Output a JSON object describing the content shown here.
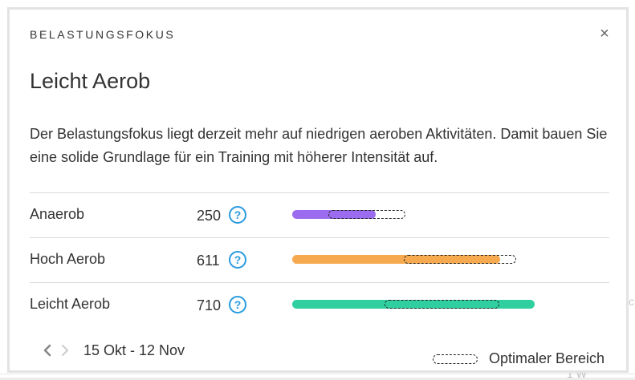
{
  "modal": {
    "header": "BELASTUNGSFOKUS",
    "close_glyph": "×",
    "title": "Leicht Aerob",
    "description": "Der Belastungsfokus liegt derzeit mehr auf niedrigen aeroben Aktivitäten. Damit bauen Sie eine solide Grundlage für ein Training mit höherer Intensität auf."
  },
  "rows": [
    {
      "label": "Anaerob",
      "value": "250",
      "help_glyph": "?",
      "color": "#9b6cf0",
      "fill_fraction": 0.29,
      "optimal_start": 0.125,
      "optimal_end": 0.385
    },
    {
      "label": "Hoch Aerob",
      "value": "611",
      "help_glyph": "?",
      "color": "#f7a94f",
      "fill_fraction": 0.72,
      "optimal_start": 0.385,
      "optimal_end": 0.77
    },
    {
      "label": "Leicht Aerob",
      "value": "710",
      "help_glyph": "?",
      "color": "#2fcf9f",
      "fill_fraction": 0.84,
      "optimal_start": 0.32,
      "optimal_end": 0.71
    }
  ],
  "footer": {
    "prev_icon": "chevron-left-icon",
    "next_icon": "chevron-right-icon",
    "date_range": "15 Okt - 12 Nov",
    "legend_label": "Optimaler Bereich"
  },
  "background": {
    "fragment_right": "c",
    "fragment_bottom": "1 W"
  }
}
